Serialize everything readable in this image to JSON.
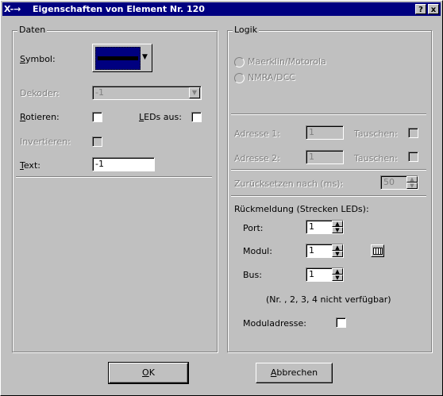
{
  "window": {
    "icon_text": "X-→",
    "title": "Eigenschaften von Element Nr. 120",
    "help_label": "?",
    "close_label": "x"
  },
  "daten": {
    "group_title": "Daten",
    "symbol_label": "Symbol:",
    "dekoder_label": "Dekoder:",
    "dekoder_value": "-1",
    "rotieren_label": "Rotieren:",
    "leds_aus_label": "LEDs aus:",
    "invertieren_label": "Invertieren:",
    "text_label": "Text:",
    "text_value": "-1"
  },
  "logik": {
    "group_title": "Logik",
    "radio_maerklin": "Maerklin/Motorola",
    "radio_nmra": "NMRA/DCC",
    "adresse1_label": "Adresse 1:",
    "adresse1_value": "1",
    "adresse2_label": "Adresse 2:",
    "adresse2_value": "1",
    "tauschen_label": "Tauschen:",
    "zurueck_label": "Zurücksetzen nach (ms):",
    "zurueck_value": "50",
    "rueck_label": "Rückmeldung (Strecken LEDs):",
    "port_label": "Port:",
    "port_value": "1",
    "modul_label": "Modul:",
    "modul_value": "1",
    "bus_label": "Bus:",
    "bus_value": "1",
    "hint": "(Nr. , 2, 3, 4 nicht verfügbar)",
    "moduladresse_label": "Moduladresse:"
  },
  "buttons": {
    "ok": "OK",
    "abbrechen": "Abbrechen"
  },
  "colors": {
    "titlebar": "#000080",
    "dialog_bg": "#c0c0c0",
    "symbol_fill": "#000080"
  }
}
